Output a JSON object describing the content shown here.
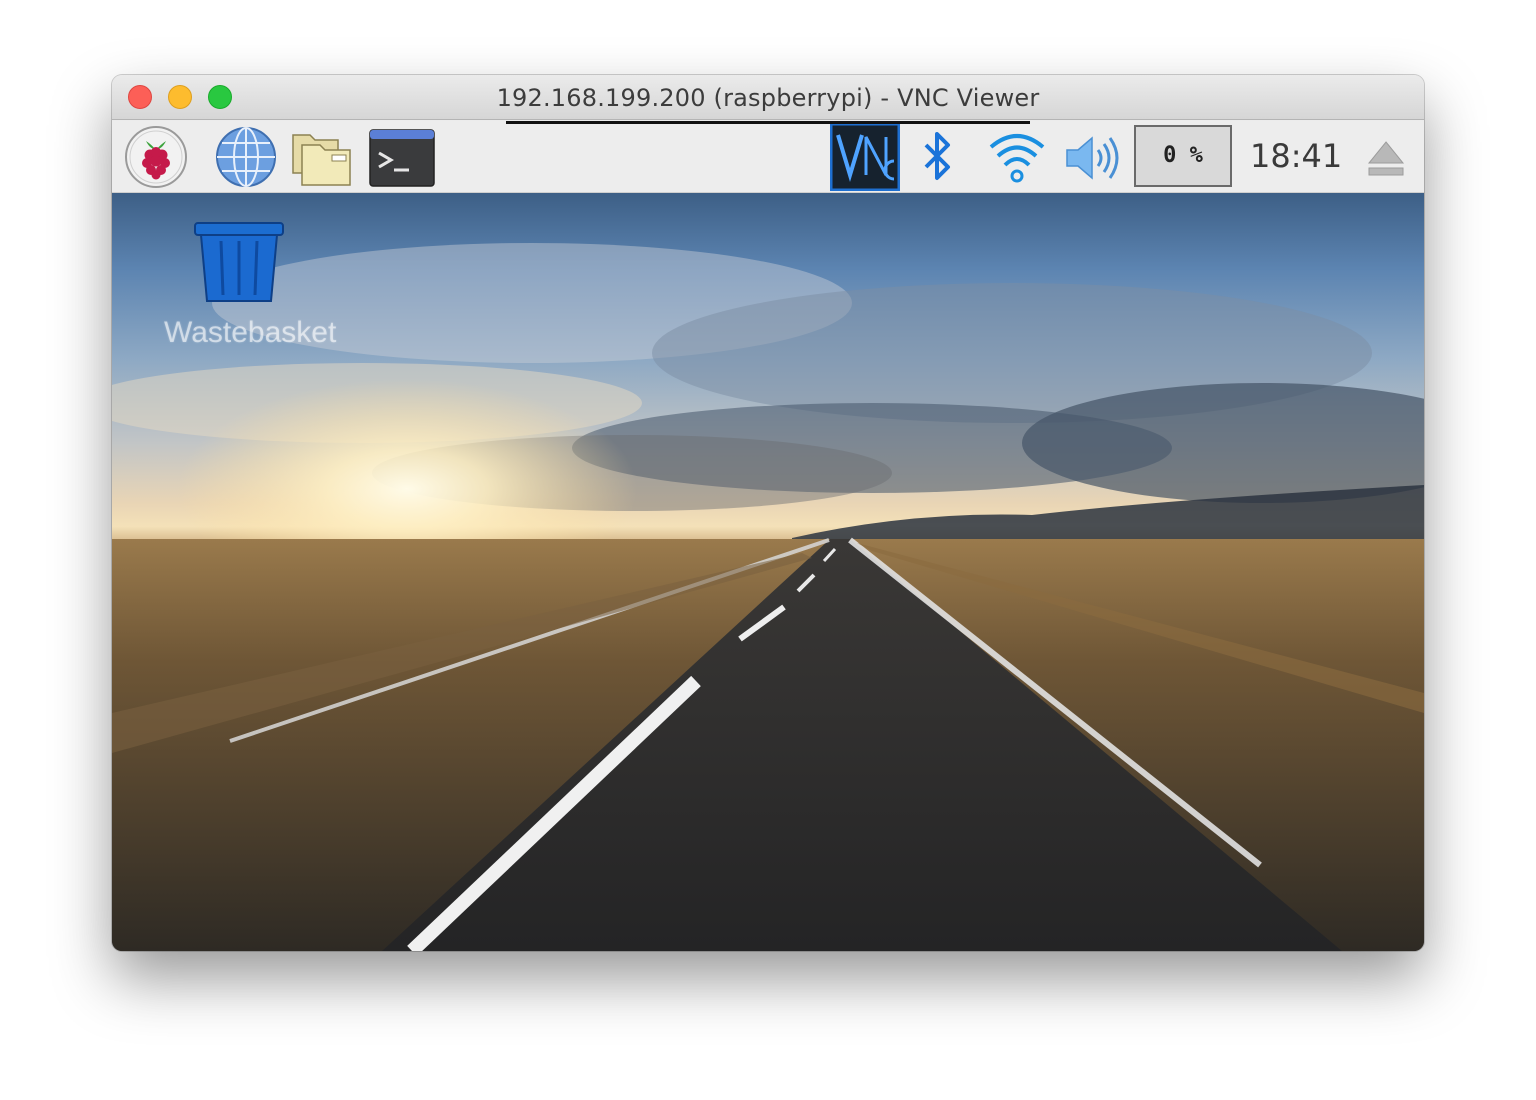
{
  "window": {
    "title": "192.168.199.200 (raspberrypi) - VNC Viewer"
  },
  "panel": {
    "launchers": [
      {
        "name": "raspberry-pi-menu",
        "icon": "raspberry-icon"
      },
      {
        "name": "web-browser",
        "icon": "globe-icon"
      },
      {
        "name": "file-manager",
        "icon": "folder-icon"
      },
      {
        "name": "terminal",
        "icon": "terminal-icon"
      }
    ],
    "tray": {
      "vnc_icon": "vnc-icon",
      "bluetooth_icon": "bluetooth-icon",
      "wifi_icon": "wifi-icon",
      "volume_icon": "speaker-icon",
      "cpu_usage": "0 %",
      "clock": "18:41",
      "eject_icon": "eject-icon"
    }
  },
  "desktop": {
    "icons": [
      {
        "label": "Wastebasket",
        "icon": "trash-icon"
      }
    ]
  },
  "colors": {
    "close": "#fc5f57",
    "minimize": "#fdbc2e",
    "maximize": "#29c840",
    "accent_blue": "#1a73d9"
  }
}
